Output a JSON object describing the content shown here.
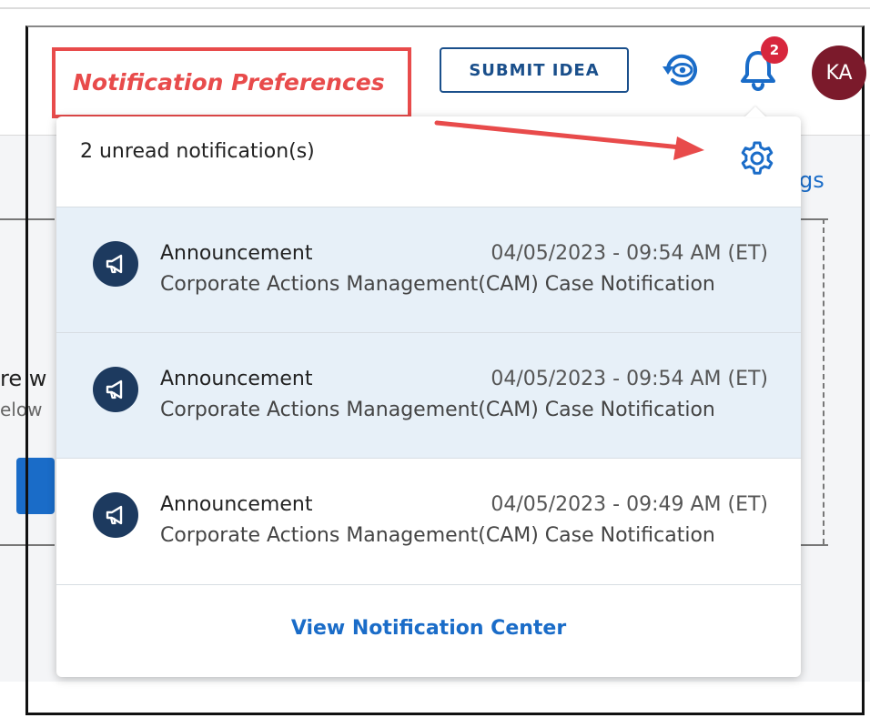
{
  "annotation": {
    "label": "Notification Preferences"
  },
  "header": {
    "submit_label": "SUBMIT IDEA",
    "bell_badge_count": "2",
    "avatar_initials": "KA"
  },
  "background": {
    "text_line_1": "re w",
    "text_line_2": "elow",
    "partial_link": "gs"
  },
  "panel": {
    "unread_summary": "2 unread notification(s)",
    "notifications": [
      {
        "title": "Announcement",
        "timestamp": "04/05/2023 - 09:54 AM (ET)",
        "message": "Corporate Actions Management(CAM) Case Notification",
        "unread": true
      },
      {
        "title": "Announcement",
        "timestamp": "04/05/2023 - 09:54 AM (ET)",
        "message": "Corporate Actions Management(CAM) Case Notification",
        "unread": true
      },
      {
        "title": "Announcement",
        "timestamp": "04/05/2023 - 09:49 AM (ET)",
        "message": "Corporate Actions Management(CAM) Case Notification",
        "unread": false
      }
    ],
    "footer_link": "View Notification Center"
  },
  "colors": {
    "accent_blue": "#1a6cc8",
    "dark_navy": "#1d3a5f",
    "annotation_red": "#e84b4b",
    "badge_red": "#d7263d",
    "avatar_maroon": "#7b1a2b",
    "unread_bg": "#e7f0f8"
  },
  "icons": {
    "history": "history-eye-icon",
    "bell": "bell-icon",
    "gear": "gear-icon",
    "notification_type": "megaphone-icon"
  }
}
